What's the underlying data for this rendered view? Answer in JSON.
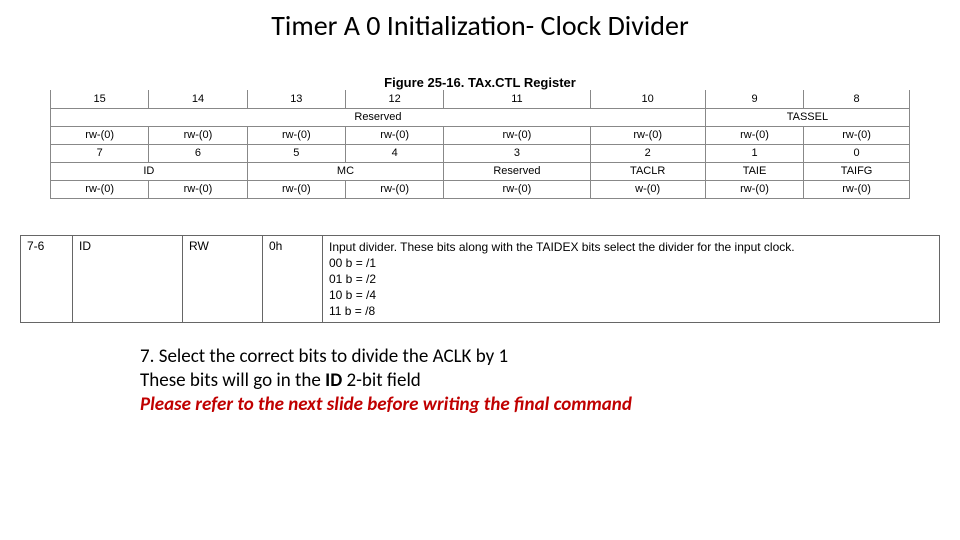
{
  "title": "Timer A 0 Initialization- Clock Divider",
  "figure_caption": "Figure 25-16. TAx.CTL Register",
  "bits_high_row": {
    "nums": [
      "15",
      "14",
      "13",
      "12",
      "11",
      "10",
      "9",
      "8"
    ],
    "labels": {
      "reserved": "Reserved",
      "tassel": "TASSEL"
    },
    "rw": "rw-(0)"
  },
  "bits_low_row": {
    "nums": [
      "7",
      "6",
      "5",
      "4",
      "3",
      "2",
      "1",
      "0"
    ],
    "labels": {
      "id": "ID",
      "mc": "MC",
      "reserved": "Reserved",
      "taclr": "TACLR",
      "taie": "TAIE",
      "taifg": "TAIFG"
    },
    "rw": "rw-(0)",
    "w0": "w-(0)"
  },
  "desc": {
    "bits": "7-6",
    "field": "ID",
    "mode": "RW",
    "reset": "0h",
    "text_intro": "Input divider. These bits along with the TAIDEX bits select the divider for the input clock.",
    "opt0": "00 b = /1",
    "opt1": "01 b = /2",
    "opt2": "10 b = /4",
    "opt3": "11 b = /8"
  },
  "instructions": {
    "line1": "7. Select the correct bits to divide the ACLK by 1",
    "line2a": "These bits will go in the ",
    "line2_id": "ID",
    "line2b": "  2-bit field",
    "line3": "Please refer to the next slide before writing the final command"
  }
}
